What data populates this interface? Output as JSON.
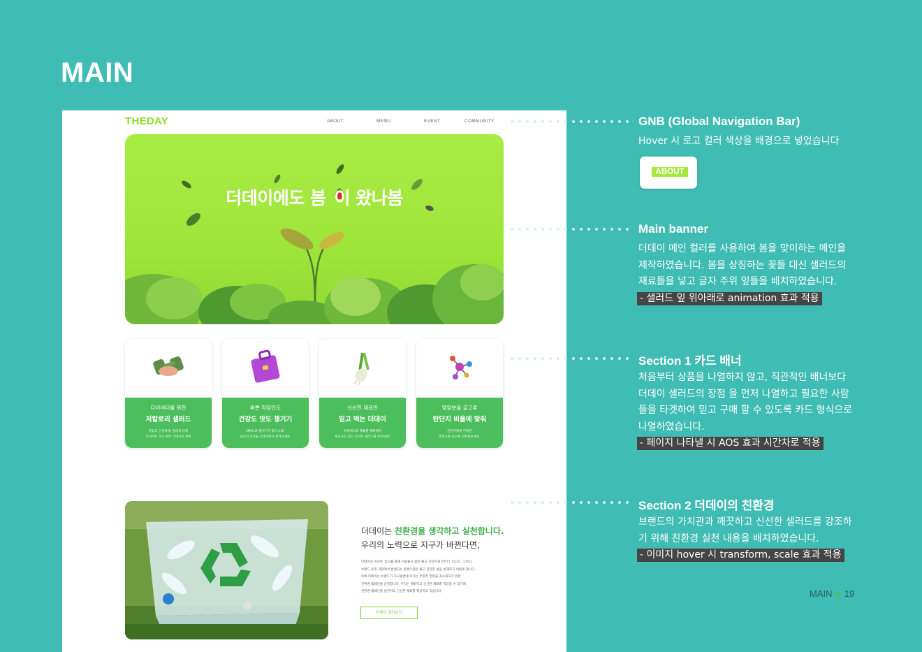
{
  "page": {
    "title": "MAIN",
    "page_label": "MAIN",
    "page_number": "19",
    "accent": "#3fbcb3"
  },
  "gnb": {
    "logo": "THEDAY",
    "nav": [
      "ABOUT",
      "MENU",
      "EVENT",
      "COMMUNITY"
    ]
  },
  "banner": {
    "headline_a": "더데이에도 봄",
    "headline_b": "이 왔나봄",
    "background": "#a4e83b"
  },
  "cards": [
    {
      "sub": "다이어터를 위한",
      "title": "저칼로리 샐러드",
      "desc1": "맛있고 건강하게, 질리지 않게",
      "desc2": "다이어트 하기 위한 더데이의 계획",
      "icon": "dumbbell-icon"
    },
    {
      "sub": "바쁜 직장인도",
      "title": "건강도 맛도 챙기기",
      "desc1": "바쁘느라 챙기기가 힘드시죠?",
      "desc2": "당신의 건강을 더데이에서 챙겨보세요.",
      "icon": "briefcase-icon"
    },
    {
      "sub": "신선한 재료만",
      "title": "믿고 먹는 더데이",
      "desc1": "자체적으로 재료를 재배하여",
      "desc2": "제공하고 있는 신선한 샐러드를 맛보세요!",
      "icon": "green-onion-icon"
    },
    {
      "sub": "영양분을 골고루",
      "title": "탄단지 비율에 맞춰",
      "desc1": "전문가에게 부족한",
      "desc2": "영양소를 골고루 섭취해보세요.",
      "icon": "molecule-icon"
    }
  ],
  "eco": {
    "line1_pre": "더데이는 ",
    "line1_hl": "친환경을 생각하고 실천합니다.",
    "line2": "우리의 노력으로 지구가 바뀐다면,",
    "body": [
      "더데이의 미션은 '음식을 통해 사람들의 삶은 좋고 건강하게 만든다' 입니다. 그러나,",
      "브랜드 운영 과정에서 발생되는 환경오염은 좋고 건강한 삶을 방해하기 어렵게 합니다.",
      "이에 더데이는 브랜드가 지구환경에 미치는 부정적 영향을 최소화하기 위한",
      "친환경 캠페인을 운영합니다. 우리는 깨끗하고 신선한 재료를 제공할 수 있기에",
      "친환경 캠페인을 실천하고 신선한 재료를 제공하고 있습니다."
    ],
    "button": "더데이 알아보기"
  },
  "annotations": {
    "gnb": {
      "title": "GNB (Global Navigation Bar)",
      "body": [
        "Hover 시 로고 컬러 색상을 배경으로 넣었습니다"
      ],
      "sample": "ABOUT"
    },
    "banner": {
      "title": "Main banner",
      "body": [
        "더데이 메인 컬러를 사용하여 봄을 맞이하는 메인을",
        "제작하였습니다. 봄을 상징하는 꽃들 대신 샐러드의",
        "재료들을 넣고 글자 주위 잎들을 배치하였습니다."
      ],
      "tag": "- 샐러드 잎 위아래로 animation 효과 적용"
    },
    "section1": {
      "title": "Section 1 카드 배너",
      "body": [
        "처음부터 상품을 나열하지 않고, 직관적인 배너보다",
        "더데이 샐러드의 장점 을 먼저 나열하고 필요한 사람",
        "들을 타겟하여 믿고 구매 할 수 있도록 카드 형식으로",
        "나열하였습니다."
      ],
      "tag": "- 페이지 나타낼 시 AOS 효과 시간차로 적용"
    },
    "section2": {
      "title": "Section 2 더데이의 친환경",
      "body": [
        "브랜드의 가치관과 깨끗하고 신선한 샐러드를 강조하",
        "기 위해 친환경 실천 내용을 배치하였습니다."
      ],
      "tag": "- 이미지 hover 시 transform, scale 효과 적용"
    }
  }
}
